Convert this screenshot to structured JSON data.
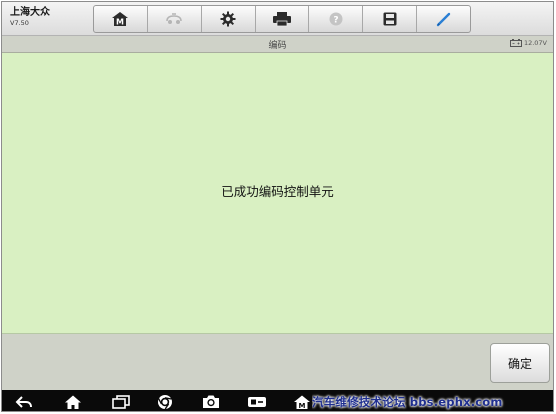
{
  "header": {
    "brand_name": "上海大众",
    "version": "V7.50",
    "toolbar": [
      {
        "icon": "home-m-icon"
      },
      {
        "icon": "vehicle-swap-icon",
        "disabled": true
      },
      {
        "icon": "gear-icon"
      },
      {
        "icon": "printer-icon"
      },
      {
        "icon": "help-icon",
        "disabled": true
      },
      {
        "icon": "save-icon"
      },
      {
        "icon": "pen-icon"
      }
    ]
  },
  "subheader": {
    "title": "编码",
    "battery_voltage": "12.07V"
  },
  "main": {
    "message": "已成功编码控制单元"
  },
  "actions": {
    "ok_label": "确定"
  },
  "navbar": {
    "icons": [
      "back-icon",
      "home-icon",
      "recent-apps-icon",
      "browser-icon",
      "camera-icon",
      "switch-icon",
      "vci-icon"
    ]
  },
  "watermark": {
    "text": "汽车维修技术论坛 bbs.ephx.com"
  },
  "colors": {
    "main_panel": "#d9f0c2",
    "chrome": "#cfd2c8",
    "toolbar_pen": "#2a7fd4",
    "navbar": "#0a0a0a"
  }
}
